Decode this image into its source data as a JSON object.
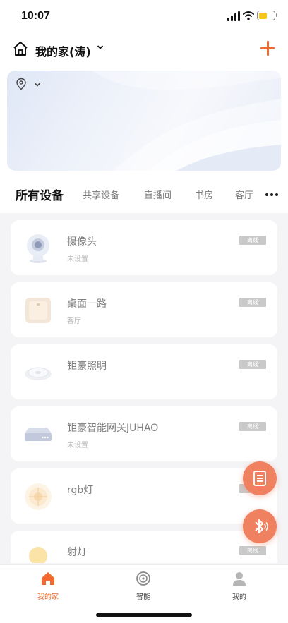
{
  "status_bar": {
    "time": "10:07",
    "battery_level": 0.55
  },
  "header": {
    "home_name": "我的家(涛)"
  },
  "tabs": [
    {
      "label": "所有设备",
      "active": true
    },
    {
      "label": "共享设备",
      "active": false
    },
    {
      "label": "直播间",
      "active": false
    },
    {
      "label": "书房",
      "active": false
    },
    {
      "label": "客厅",
      "active": false
    }
  ],
  "devices": [
    {
      "name": "摄像头",
      "room": "未设置",
      "status": "离线",
      "icon": "camera-icon"
    },
    {
      "name": "桌面一路",
      "room": "客厅",
      "status": "离线",
      "icon": "wall-switch-icon"
    },
    {
      "name": "钜豪照明",
      "room": "",
      "status": "离线",
      "icon": "ceiling-light-icon"
    },
    {
      "name": "钜豪智能网关JUHAO",
      "room": "未设置",
      "status": "离线",
      "icon": "gateway-icon"
    },
    {
      "name": "rgb灯",
      "room": "",
      "status": "离线",
      "icon": "rgb-light-icon"
    },
    {
      "name": "射灯",
      "room": "",
      "status": "离线",
      "icon": "bulb-icon"
    }
  ],
  "bottom_nav": [
    {
      "label": "我的家",
      "icon": "home-icon",
      "active": true
    },
    {
      "label": "智能",
      "icon": "smart-icon",
      "active": false
    },
    {
      "label": "我的",
      "icon": "profile-icon",
      "active": false
    }
  ],
  "colors": {
    "accent": "#ef6a2e",
    "fab": "#ef8060",
    "badge": "#c9c9c9"
  }
}
